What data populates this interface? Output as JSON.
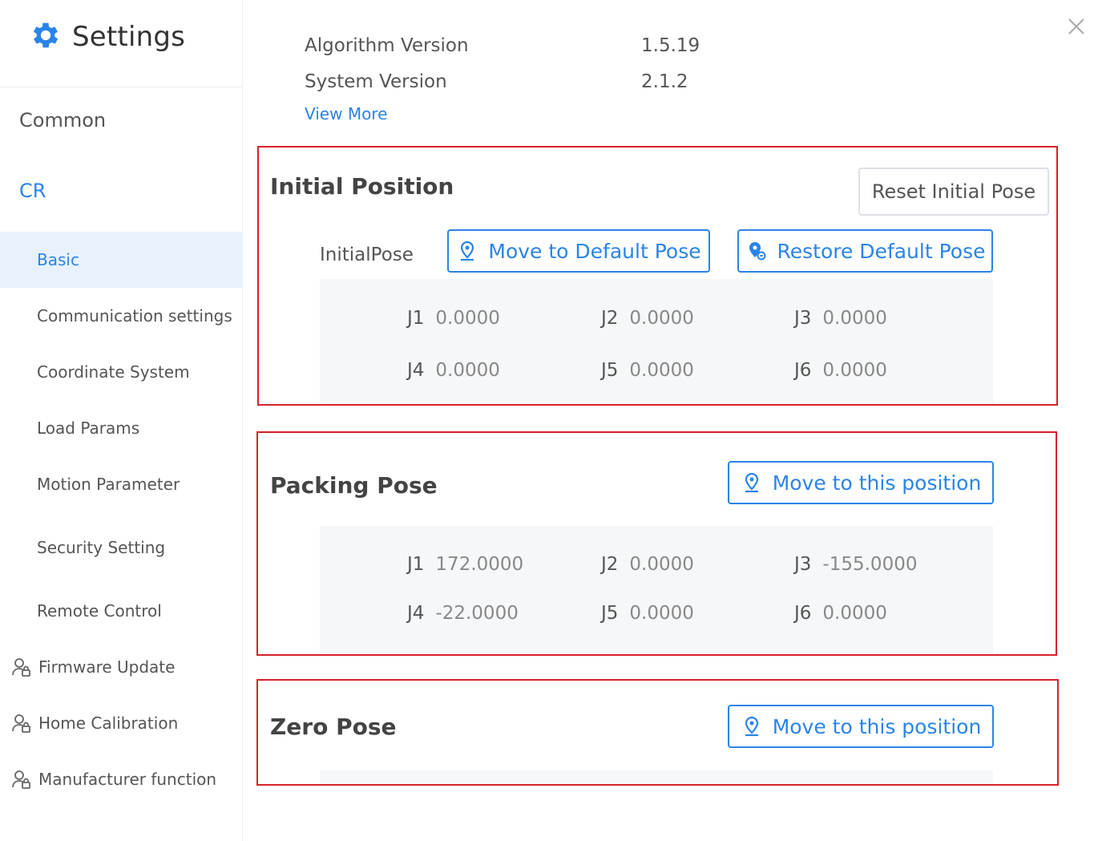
{
  "sidebar": {
    "title": "Settings",
    "group_common": "Common",
    "group_cr": "CR",
    "items": [
      {
        "label": "Basic"
      },
      {
        "label": "Communication settings"
      },
      {
        "label": "Coordinate System"
      },
      {
        "label": "Load Params"
      },
      {
        "label": "Motion Parameter"
      },
      {
        "label": "Security Setting"
      },
      {
        "label": "Remote Control"
      },
      {
        "label": "Firmware Update",
        "icon": "user-lock-icon"
      },
      {
        "label": "Home Calibration",
        "icon": "user-lock-icon"
      },
      {
        "label": "Manufacturer function",
        "icon": "user-lock-icon"
      }
    ]
  },
  "versions": {
    "algorithm_label": "Algorithm Version",
    "algorithm_value": "1.5.19",
    "system_label": "System Version",
    "system_value": "2.1.2",
    "view_more": "View More"
  },
  "initial_position": {
    "title": "Initial Position",
    "reset_label": "Reset Initial Pose",
    "pose_label": "InitialPose",
    "move_default_label": "Move to Default Pose",
    "restore_default_label": "Restore Default Pose",
    "joints": [
      {
        "name": "J1",
        "value": "0.0000"
      },
      {
        "name": "J2",
        "value": "0.0000"
      },
      {
        "name": "J3",
        "value": "0.0000"
      },
      {
        "name": "J4",
        "value": "0.0000"
      },
      {
        "name": "J5",
        "value": "0.0000"
      },
      {
        "name": "J6",
        "value": "0.0000"
      }
    ]
  },
  "packing_pose": {
    "title": "Packing Pose",
    "move_label": "Move to this position",
    "joints": [
      {
        "name": "J1",
        "value": "172.0000"
      },
      {
        "name": "J2",
        "value": "0.0000"
      },
      {
        "name": "J3",
        "value": "-155.0000"
      },
      {
        "name": "J4",
        "value": "-22.0000"
      },
      {
        "name": "J5",
        "value": "0.0000"
      },
      {
        "name": "J6",
        "value": "0.0000"
      }
    ]
  },
  "zero_pose": {
    "title": "Zero Pose",
    "move_label": "Move to this position"
  },
  "colors": {
    "accent": "#2a84e8",
    "highlight_border": "#d8202a",
    "active_bg": "#e7f2fd"
  }
}
